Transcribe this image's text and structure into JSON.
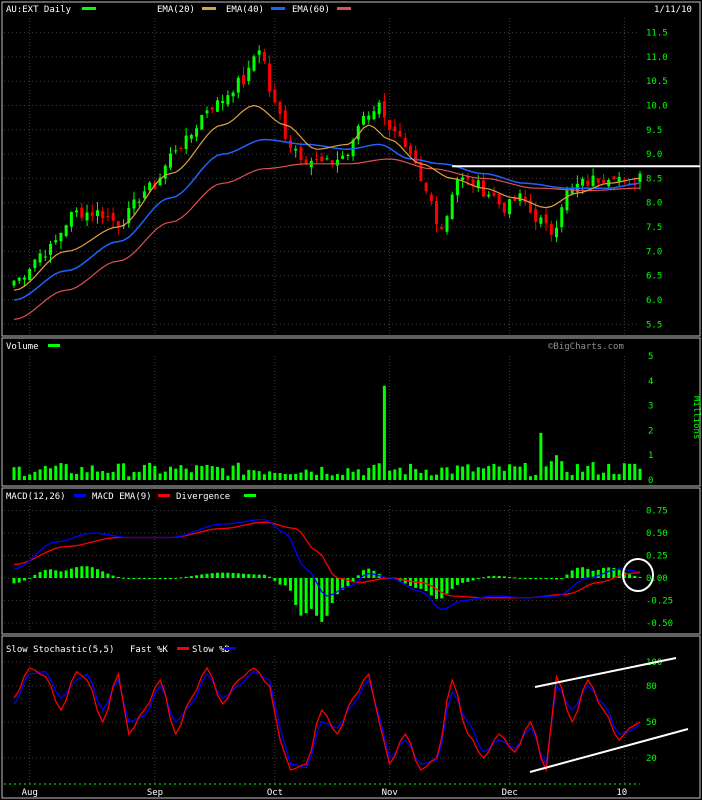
{
  "header": {
    "symbol": "AU:EXT Daily",
    "ema20": "EMA(20)",
    "ema40": "EMA(40)",
    "ema60": "EMA(60)",
    "date": "1/11/10"
  },
  "colors": {
    "up": "#00ff00",
    "down": "#ff0000",
    "ema20": "#e0a040",
    "ema40": "#2060ff",
    "ema60": "#e05050",
    "axis": "#00ff00",
    "grid": "#404040",
    "frame": "#c0c0c0",
    "white": "#ffffff",
    "macd": "#0000ff",
    "signal": "#ff0000",
    "fastK": "#ff0000",
    "slowD": "#0000ff"
  },
  "volume_panel": {
    "label": "Volume",
    "watermark": "©BigCharts.com",
    "unit_label": "Millions"
  },
  "macd_panel": {
    "label": "MACD(12,26)",
    "ema_label": "MACD EMA(9)",
    "div_label": "Divergence"
  },
  "stoch_panel": {
    "label": "Slow Stochastic(5,5)",
    "fast_label": "Fast %K",
    "slow_label": "Slow %D"
  },
  "chart_data": [
    {
      "type": "candlestick",
      "panel": "price",
      "ylim": [
        5.3,
        11.8
      ],
      "yticks": [
        "5.5",
        "6.0",
        "6.5",
        "7.0",
        "7.5",
        "8.0",
        "8.5",
        "9.0",
        "9.5",
        "10.0",
        "10.5",
        "11.0",
        "11.5"
      ],
      "x_ticks": [
        "Aug",
        "Sep",
        "Oct",
        "Nov",
        "Dec",
        "10"
      ],
      "resistance_level": 8.75,
      "close_anchors": [
        [
          0,
          6.4
        ],
        [
          6,
          7.0
        ],
        [
          12,
          7.8
        ],
        [
          16,
          7.8
        ],
        [
          20,
          7.6
        ],
        [
          26,
          8.3
        ],
        [
          32,
          9.2
        ],
        [
          38,
          10.0
        ],
        [
          44,
          10.5
        ],
        [
          47,
          11.2
        ],
        [
          50,
          10.0
        ],
        [
          53,
          9.2
        ],
        [
          56,
          8.9
        ],
        [
          60,
          8.8
        ],
        [
          64,
          9.0
        ],
        [
          67,
          9.8
        ],
        [
          70,
          10.0
        ],
        [
          73,
          9.4
        ],
        [
          76,
          8.9
        ],
        [
          79,
          8.2
        ],
        [
          82,
          7.5
        ],
        [
          85,
          8.5
        ],
        [
          88,
          8.4
        ],
        [
          91,
          8.2
        ],
        [
          94,
          7.9
        ],
        [
          97,
          8.1
        ],
        [
          100,
          7.7
        ],
        [
          103,
          7.4
        ],
        [
          106,
          8.2
        ],
        [
          109,
          8.4
        ],
        [
          112,
          8.5
        ],
        [
          115,
          8.6
        ],
        [
          118,
          8.3
        ],
        [
          120,
          8.6
        ]
      ],
      "ema20_anchors": [
        [
          0,
          6.2
        ],
        [
          10,
          7.0
        ],
        [
          20,
          7.5
        ],
        [
          30,
          8.6
        ],
        [
          40,
          9.6
        ],
        [
          46,
          10.0
        ],
        [
          52,
          9.6
        ],
        [
          58,
          9.1
        ],
        [
          64,
          9.2
        ],
        [
          68,
          9.6
        ],
        [
          72,
          9.3
        ],
        [
          78,
          8.8
        ],
        [
          84,
          8.5
        ],
        [
          90,
          8.3
        ],
        [
          96,
          8.1
        ],
        [
          102,
          7.9
        ],
        [
          108,
          8.2
        ],
        [
          114,
          8.4
        ],
        [
          120,
          8.5
        ]
      ],
      "ema40_anchors": [
        [
          0,
          6.0
        ],
        [
          10,
          6.6
        ],
        [
          20,
          7.2
        ],
        [
          30,
          8.1
        ],
        [
          40,
          9.0
        ],
        [
          48,
          9.3
        ],
        [
          56,
          9.2
        ],
        [
          64,
          9.1
        ],
        [
          70,
          9.2
        ],
        [
          76,
          8.9
        ],
        [
          82,
          8.8
        ],
        [
          90,
          8.6
        ],
        [
          98,
          8.4
        ],
        [
          106,
          8.3
        ],
        [
          114,
          8.3
        ],
        [
          120,
          8.4
        ]
      ],
      "ema60_anchors": [
        [
          0,
          5.6
        ],
        [
          10,
          6.2
        ],
        [
          20,
          6.8
        ],
        [
          30,
          7.6
        ],
        [
          40,
          8.4
        ],
        [
          48,
          8.7
        ],
        [
          56,
          8.8
        ],
        [
          64,
          8.8
        ],
        [
          72,
          8.9
        ],
        [
          80,
          8.7
        ],
        [
          90,
          8.5
        ],
        [
          100,
          8.3
        ],
        [
          110,
          8.25
        ],
        [
          120,
          8.3
        ]
      ],
      "n_bars": 121
    },
    {
      "type": "bar",
      "panel": "volume",
      "ylim": [
        0,
        5
      ],
      "yticks": [
        "0",
        "1",
        "2",
        "3",
        "4",
        "5"
      ],
      "ylabel": "Millions",
      "spikes": [
        [
          71,
          3.8
        ],
        [
          101,
          1.9
        ],
        [
          104,
          1.0
        ]
      ]
    },
    {
      "type": "line",
      "panel": "macd",
      "ylim": [
        -0.6,
        0.8
      ],
      "yticks": [
        "-0.50",
        "-0.25",
        "0.00",
        "0.25",
        "0.50",
        "0.75"
      ],
      "macd_anchors": [
        [
          0,
          0.1
        ],
        [
          8,
          0.4
        ],
        [
          15,
          0.5
        ],
        [
          22,
          0.45
        ],
        [
          30,
          0.45
        ],
        [
          40,
          0.6
        ],
        [
          48,
          0.65
        ],
        [
          52,
          0.5
        ],
        [
          56,
          0.1
        ],
        [
          60,
          -0.2
        ],
        [
          64,
          -0.1
        ],
        [
          68,
          0.05
        ],
        [
          72,
          0.0
        ],
        [
          78,
          -0.15
        ],
        [
          82,
          -0.35
        ],
        [
          86,
          -0.25
        ],
        [
          92,
          -0.2
        ],
        [
          98,
          -0.22
        ],
        [
          104,
          -0.2
        ],
        [
          110,
          0.0
        ],
        [
          116,
          0.1
        ],
        [
          120,
          0.07
        ]
      ],
      "signal_anchors": [
        [
          0,
          0.15
        ],
        [
          10,
          0.35
        ],
        [
          20,
          0.45
        ],
        [
          30,
          0.45
        ],
        [
          40,
          0.55
        ],
        [
          48,
          0.62
        ],
        [
          54,
          0.55
        ],
        [
          58,
          0.3
        ],
        [
          62,
          0.0
        ],
        [
          66,
          -0.05
        ],
        [
          72,
          0.0
        ],
        [
          78,
          -0.05
        ],
        [
          84,
          -0.2
        ],
        [
          90,
          -0.22
        ],
        [
          98,
          -0.22
        ],
        [
          106,
          -0.18
        ],
        [
          112,
          -0.05
        ],
        [
          118,
          0.05
        ],
        [
          120,
          0.06
        ]
      ]
    },
    {
      "type": "line",
      "panel": "stochastic",
      "ylim": [
        0,
        105
      ],
      "yticks": [
        "20",
        "50",
        "80",
        "100"
      ],
      "k_anchors": [
        [
          0,
          70
        ],
        [
          3,
          95
        ],
        [
          6,
          88
        ],
        [
          9,
          60
        ],
        [
          12,
          92
        ],
        [
          14,
          85
        ],
        [
          17,
          50
        ],
        [
          20,
          90
        ],
        [
          22,
          40
        ],
        [
          25,
          60
        ],
        [
          28,
          85
        ],
        [
          31,
          40
        ],
        [
          34,
          70
        ],
        [
          37,
          95
        ],
        [
          40,
          65
        ],
        [
          43,
          85
        ],
        [
          46,
          95
        ],
        [
          49,
          80
        ],
        [
          51,
          35
        ],
        [
          53,
          10
        ],
        [
          56,
          15
        ],
        [
          59,
          60
        ],
        [
          62,
          40
        ],
        [
          65,
          70
        ],
        [
          68,
          90
        ],
        [
          70,
          50
        ],
        [
          72,
          15
        ],
        [
          75,
          40
        ],
        [
          78,
          10
        ],
        [
          81,
          20
        ],
        [
          84,
          85
        ],
        [
          87,
          40
        ],
        [
          90,
          20
        ],
        [
          93,
          40
        ],
        [
          96,
          25
        ],
        [
          99,
          50
        ],
        [
          102,
          10
        ],
        [
          104,
          88
        ],
        [
          107,
          50
        ],
        [
          110,
          85
        ],
        [
          113,
          60
        ],
        [
          116,
          35
        ],
        [
          118,
          45
        ],
        [
          120,
          50
        ]
      ],
      "d_anchors": [
        [
          0,
          65
        ],
        [
          3,
          90
        ],
        [
          6,
          92
        ],
        [
          9,
          70
        ],
        [
          12,
          85
        ],
        [
          14,
          90
        ],
        [
          17,
          60
        ],
        [
          20,
          85
        ],
        [
          22,
          50
        ],
        [
          25,
          55
        ],
        [
          28,
          80
        ],
        [
          31,
          50
        ],
        [
          34,
          65
        ],
        [
          37,
          90
        ],
        [
          40,
          70
        ],
        [
          43,
          80
        ],
        [
          46,
          92
        ],
        [
          49,
          85
        ],
        [
          51,
          45
        ],
        [
          53,
          15
        ],
        [
          56,
          12
        ],
        [
          59,
          50
        ],
        [
          62,
          45
        ],
        [
          65,
          65
        ],
        [
          68,
          85
        ],
        [
          70,
          55
        ],
        [
          72,
          20
        ],
        [
          75,
          35
        ],
        [
          78,
          15
        ],
        [
          81,
          18
        ],
        [
          84,
          75
        ],
        [
          87,
          50
        ],
        [
          90,
          25
        ],
        [
          93,
          35
        ],
        [
          96,
          28
        ],
        [
          99,
          45
        ],
        [
          102,
          15
        ],
        [
          104,
          80
        ],
        [
          107,
          60
        ],
        [
          110,
          80
        ],
        [
          113,
          65
        ],
        [
          116,
          40
        ],
        [
          118,
          42
        ],
        [
          120,
          48
        ]
      ]
    }
  ]
}
